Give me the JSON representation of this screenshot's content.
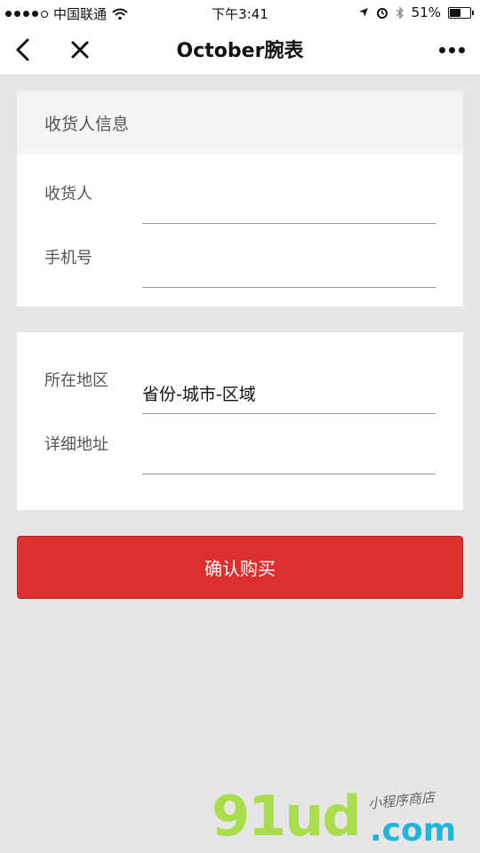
{
  "status_bar": {
    "carrier": "中国联通",
    "time": "下午3:41",
    "battery": "51%",
    "battery_level": 0.51
  },
  "nav": {
    "title": "October腕表",
    "icons": {
      "back": "chevron-left-icon",
      "close": "close-icon",
      "more": "more-dots-icon"
    }
  },
  "consignee": {
    "header": "收货人信息",
    "name_label": "收货人",
    "name_value": "",
    "phone_label": "手机号",
    "phone_value": ""
  },
  "address": {
    "region_label": "所在地区",
    "region_value": "省份-城市-区域",
    "detail_label": "详细地址",
    "detail_value": ""
  },
  "confirm_button": "确认购买",
  "watermark": {
    "main": "91ud",
    "domain": ".com",
    "tagline": "小程序商店"
  },
  "colors": {
    "accent": "#dc3030",
    "background": "#e6e6e6",
    "watermark_green": "#a8de4b",
    "watermark_blue": "#1fb6dc"
  }
}
